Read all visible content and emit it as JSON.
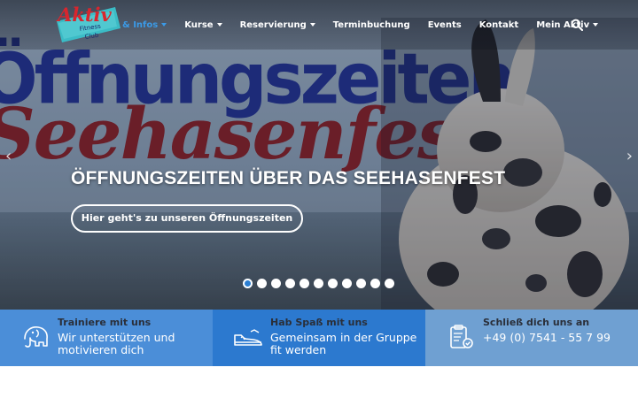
{
  "nav": {
    "logo_text": "Aktiv",
    "logo_sub": "Fitness Club",
    "items": [
      {
        "label": "& Infos",
        "dropdown": true,
        "active": true
      },
      {
        "label": "Kurse",
        "dropdown": true,
        "active": false
      },
      {
        "label": "Reservierung",
        "dropdown": true,
        "active": false
      },
      {
        "label": "Terminbuchung",
        "dropdown": false,
        "active": false
      },
      {
        "label": "Events",
        "dropdown": false,
        "active": false
      },
      {
        "label": "Kontakt",
        "dropdown": false,
        "active": false
      },
      {
        "label": "Mein Aktiv",
        "dropdown": true,
        "active": false
      }
    ],
    "search_icon": "search-icon"
  },
  "hero": {
    "bg_word1": "Öffnungszeiten",
    "bg_word2": "Seehasenfest",
    "headline": "ÖFFNUNGSZEITEN ÜBER DAS SEEHASENFEST",
    "cta_label": "Hier geht's zu unseren Öffnungszeiten",
    "prev_arrow": "‹",
    "next_arrow": "›",
    "slide_count": 11,
    "active_slide": 1
  },
  "features": [
    {
      "title": "Trainiere mit uns",
      "subtitle": "Wir unterstützen und motivieren dich",
      "icon": "elephant-icon",
      "bg": "#4b8ed8"
    },
    {
      "title": "Hab Spaß mit uns",
      "subtitle": "Gemeinsam in der Gruppe fit werden",
      "icon": "sneaker-icon",
      "bg": "#2c79cf"
    },
    {
      "title": "Schließ dich uns an",
      "subtitle": "+49 (0) 7541 - 55 7 99",
      "icon": "clipboard-icon",
      "bg": "#6fa0d2"
    }
  ],
  "colors": {
    "nav_active": "#3b9ae6",
    "accent_blue": "#2c79cf",
    "logo_red": "#d8262e",
    "logo_teal": "#3bbcc6"
  }
}
